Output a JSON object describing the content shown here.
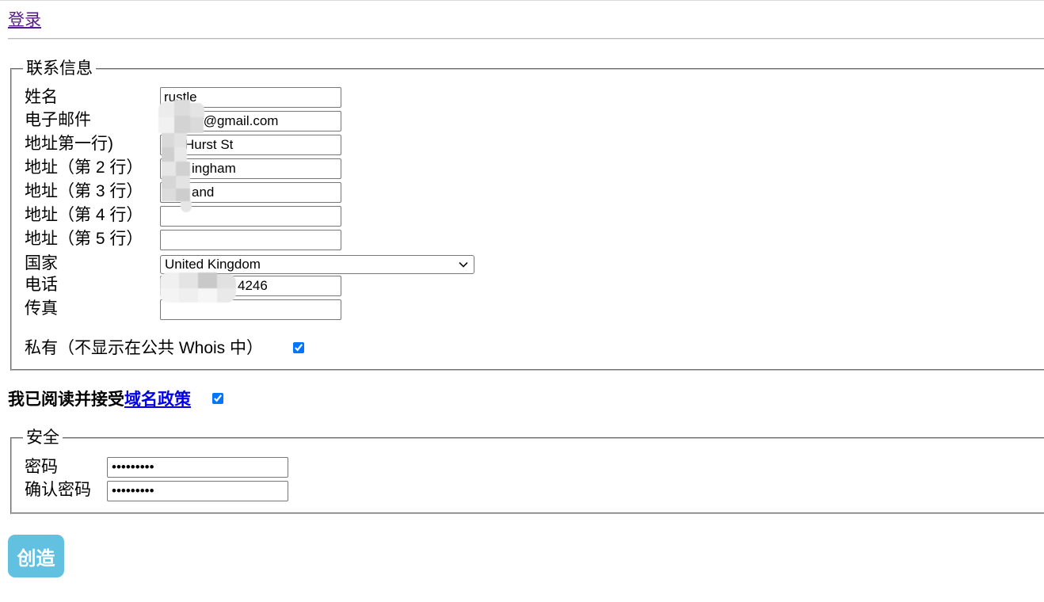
{
  "header": {
    "login_link": "登录"
  },
  "contact": {
    "legend": "联系信息",
    "fields": [
      {
        "label": "姓名",
        "value": "rustle"
      },
      {
        "label": "电子邮件",
        "value": "f@gmail.com"
      },
      {
        "label": "地址第一行)",
        "value": "Hurst St"
      },
      {
        "label": "地址（第 2 行）",
        "value": "ingham"
      },
      {
        "label": "地址（第 3 行）",
        "value": "and"
      },
      {
        "label": "地址（第 4 行）",
        "value": ""
      },
      {
        "label": "地址（第 5 行）",
        "value": ""
      }
    ],
    "country": {
      "label": "国家",
      "selected": "United Kingdom"
    },
    "phone": {
      "label": "电话",
      "value": "4246"
    },
    "fax": {
      "label": "传真",
      "value": ""
    },
    "private": {
      "label": "私有（不显示在公共 Whois 中）",
      "checked": true
    }
  },
  "agreement": {
    "text": "我已阅读并接受",
    "link_text": "域名政策",
    "checked": true
  },
  "security": {
    "legend": "安全",
    "password": {
      "label": "密码",
      "value": "•••••••••"
    },
    "confirm": {
      "label": "确认密码",
      "value": "•••••••••"
    }
  },
  "submit": {
    "label": "创造"
  },
  "colors": {
    "link_visited": "#551a8b",
    "link": "#0000ee",
    "button_bg": "#62c1e1",
    "checkbox_accent": "#0075ff"
  }
}
